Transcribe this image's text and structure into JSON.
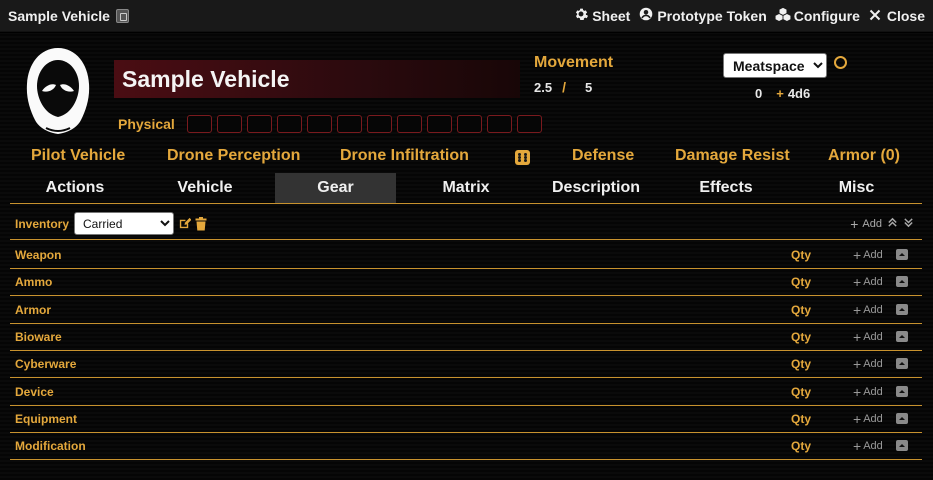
{
  "window": {
    "title": "Sample Vehicle",
    "actions": [
      {
        "label": "Sheet",
        "icon": "gear-icon"
      },
      {
        "label": "Prototype Token",
        "icon": "user-circle-icon"
      },
      {
        "label": "Configure",
        "icon": "cubes-icon"
      },
      {
        "label": "Close",
        "icon": "close-icon"
      }
    ]
  },
  "header": {
    "name": "Sample Vehicle",
    "physical_label": "Physical",
    "physical_boxes": 12,
    "movement": {
      "label": "Movement",
      "walk": "2.5",
      "sep": "/",
      "run": "5"
    },
    "space_select": {
      "value": "Meatspace",
      "options": [
        "Meatspace"
      ]
    },
    "initiative": {
      "base": "0",
      "plus": "+",
      "dice": "4d6"
    }
  },
  "skills": [
    {
      "label": "Pilot Vehicle"
    },
    {
      "label": "Drone Perception"
    },
    {
      "label": "Drone Infiltration"
    },
    {
      "label": "Defense"
    },
    {
      "label": "Damage Resist"
    },
    {
      "label": "Armor (0)"
    }
  ],
  "tabs": [
    {
      "label": "Actions"
    },
    {
      "label": "Vehicle"
    },
    {
      "label": "Gear",
      "active": true
    },
    {
      "label": "Matrix"
    },
    {
      "label": "Description"
    },
    {
      "label": "Effects"
    },
    {
      "label": "Misc"
    }
  ],
  "inventory": {
    "label": "Inventory",
    "select": {
      "value": "Carried",
      "options": [
        "Carried"
      ]
    },
    "add_label": "Add"
  },
  "categories": [
    {
      "name": "Weapon",
      "qty": "Qty",
      "add": "Add"
    },
    {
      "name": "Ammo",
      "qty": "Qty",
      "add": "Add"
    },
    {
      "name": "Armor",
      "qty": "Qty",
      "add": "Add"
    },
    {
      "name": "Bioware",
      "qty": "Qty",
      "add": "Add"
    },
    {
      "name": "Cyberware",
      "qty": "Qty",
      "add": "Add"
    },
    {
      "name": "Device",
      "qty": "Qty",
      "add": "Add"
    },
    {
      "name": "Equipment",
      "qty": "Qty",
      "add": "Add"
    },
    {
      "name": "Modification",
      "qty": "Qty",
      "add": "Add"
    }
  ],
  "colors": {
    "accent": "#e4a83c",
    "name_bg": "#4a0d13",
    "monitor_border": "#7a1a1e"
  }
}
